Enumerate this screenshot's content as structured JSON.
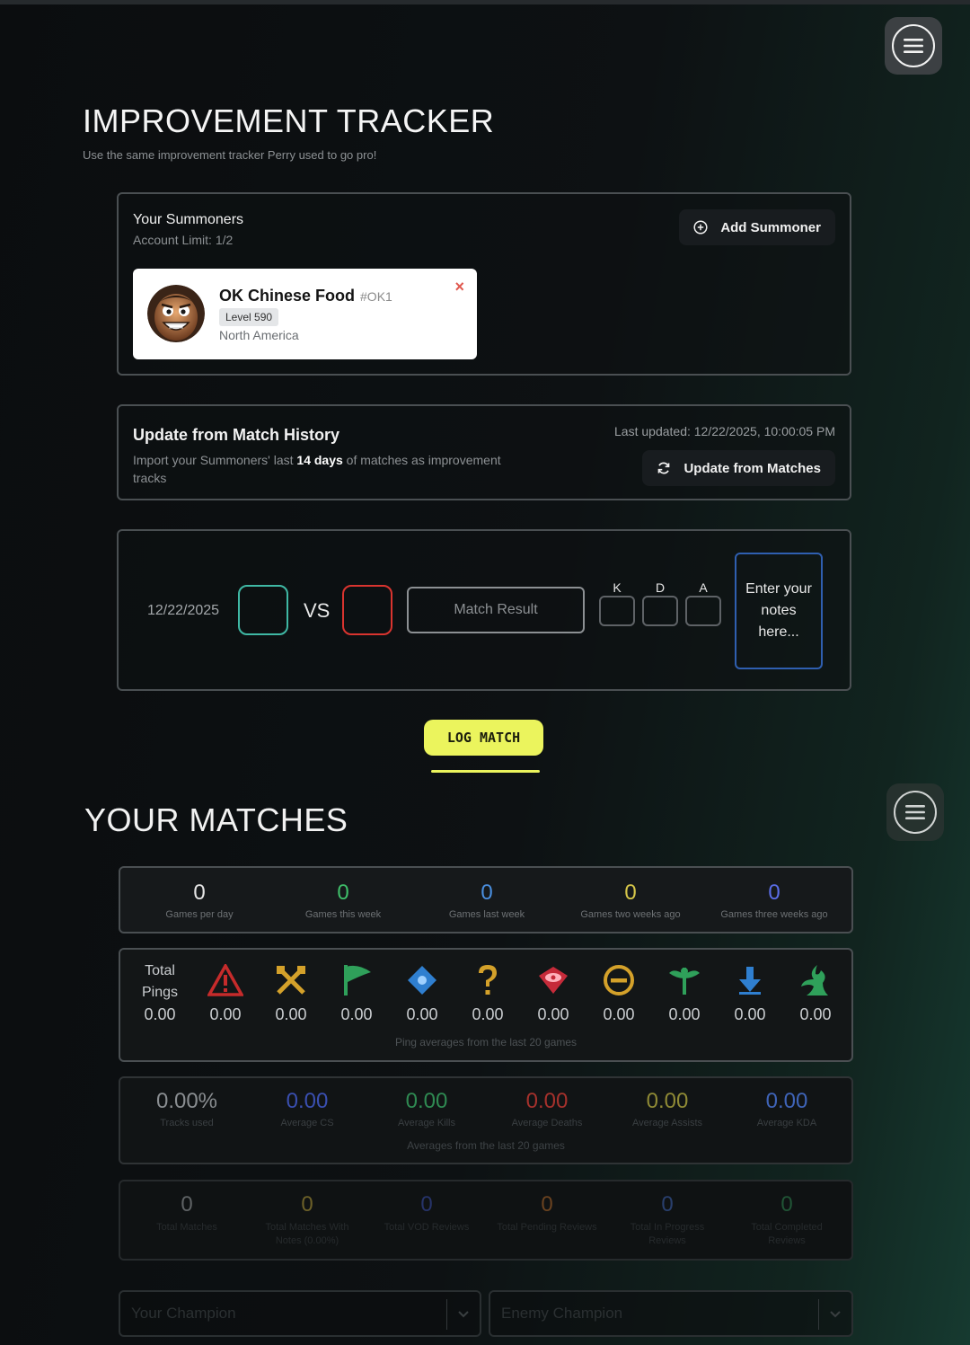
{
  "page": {
    "title": "IMPROVEMENT TRACKER",
    "subtitle": "Use the same improvement tracker Perry used to go pro!"
  },
  "summoners": {
    "title": "Your Summoners",
    "limit": "Account Limit: 1/2",
    "add_label": "Add Summoner",
    "card": {
      "name": "OK Chinese Food",
      "tag": "#OK1",
      "level": "Level 590",
      "region": "North America",
      "close": "×"
    }
  },
  "update": {
    "title": "Update from Match History",
    "desc_before": "Import your Summoners' last ",
    "desc_bold": "14 days",
    "desc_after": " of matches as improvement tracks",
    "last_updated": "Last updated: 12/22/2025, 10:00:05 PM",
    "button_label": "Update from Matches"
  },
  "log_form": {
    "date": "12/22/2025",
    "vs": "VS",
    "match_result_placeholder": "Match Result",
    "kda_labels": [
      "K",
      "D",
      "A"
    ],
    "notes_placeholder": "Enter your notes here...",
    "ally_color": "#3fb8a4",
    "enemy_color": "#d9342f",
    "log_button": "LOG MATCH"
  },
  "matches": {
    "title": "YOUR MATCHES",
    "frequency": [
      {
        "value": "0",
        "label": "Games per day",
        "color": "#e6e6e6"
      },
      {
        "value": "0",
        "label": "Games this week",
        "color": "#3fbf6a"
      },
      {
        "value": "0",
        "label": "Games last week",
        "color": "#4a8fe0"
      },
      {
        "value": "0",
        "label": "Games two weeks ago",
        "color": "#d8c84a"
      },
      {
        "value": "0",
        "label": "Games three weeks ago",
        "color": "#5b6ee8"
      }
    ],
    "pings": {
      "head_line1": "Total",
      "head_line2": "Pings",
      "total": "0.00",
      "values": [
        "0.00",
        "0.00",
        "0.00",
        "0.00",
        "0.00",
        "0.00",
        "0.00",
        "0.00",
        "0.00",
        "0.00"
      ],
      "icons": [
        "danger-ping-icon",
        "all-in-ping-icon",
        "push-ping-icon",
        "vision-ping-icon",
        "missing-ping-icon",
        "enemy-vision-ping-icon",
        "retreat-ping-icon",
        "need-vision-ping-icon",
        "on-my-way-ping-icon",
        "assist-me-ping-icon"
      ],
      "footer": "Ping averages from the last 20 games"
    },
    "averages": {
      "items": [
        {
          "value": "0.00%",
          "label": "Tracks used",
          "color": "#8a8e91"
        },
        {
          "value": "0.00",
          "label": "Average CS",
          "color": "#3a4fb0"
        },
        {
          "value": "0.00",
          "label": "Average Kills",
          "color": "#2f8a52"
        },
        {
          "value": "0.00",
          "label": "Average Deaths",
          "color": "#a5312c"
        },
        {
          "value": "0.00",
          "label": "Average Assists",
          "color": "#8f8a35"
        },
        {
          "value": "0.00",
          "label": "Average KDA",
          "color": "#3f64b8"
        }
      ],
      "footer": "Averages from the last 20 games"
    },
    "totals": [
      {
        "value": "0",
        "label": "Total Matches",
        "color": "#a0a4a7"
      },
      {
        "value": "0",
        "label": "Total Matches With Notes (0.00%)",
        "color": "#b8a03a"
      },
      {
        "value": "0",
        "label": "Total VOD Reviews",
        "color": "#3a4fb0"
      },
      {
        "value": "0",
        "label": "Total Pending Reviews",
        "color": "#b56a2a"
      },
      {
        "value": "0",
        "label": "Total In Progress Reviews",
        "color": "#3f64b8"
      },
      {
        "value": "0",
        "label": "Total Completed Reviews",
        "color": "#2f8a52"
      }
    ],
    "filters": {
      "your_champion": "Your Champion",
      "enemy_champion": "Enemy Champion"
    }
  }
}
